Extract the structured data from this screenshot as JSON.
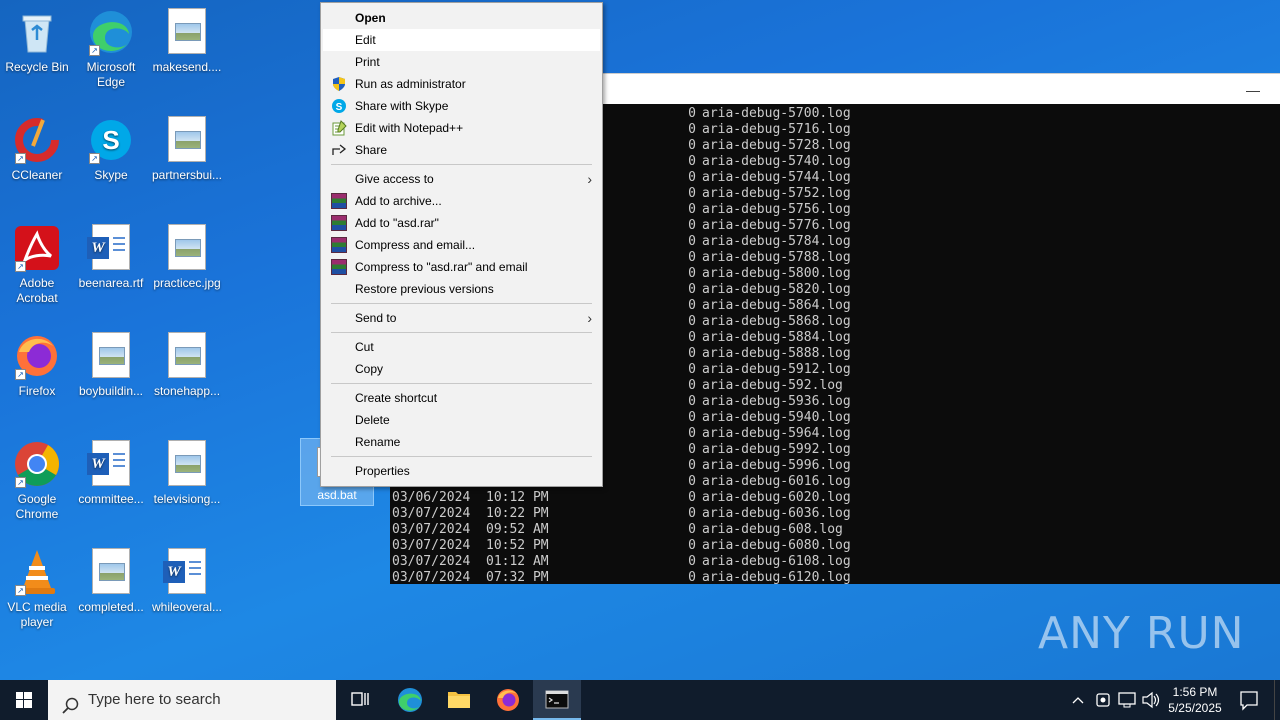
{
  "desktop": {
    "icons": [
      {
        "label": "Recycle Bin"
      },
      {
        "label": "Microsoft Edge"
      },
      {
        "label": "makesend...."
      },
      {
        "label": "CCleaner"
      },
      {
        "label": "Skype"
      },
      {
        "label": "partnersbui..."
      },
      {
        "label": "Adobe Acrobat"
      },
      {
        "label": "beenarea.rtf"
      },
      {
        "label": "practicec.jpg"
      },
      {
        "label": "Firefox"
      },
      {
        "label": "boybuildin..."
      },
      {
        "label": "stonehapp..."
      },
      {
        "label": "Google Chrome"
      },
      {
        "label": "committee..."
      },
      {
        "label": "televisiong..."
      },
      {
        "label": "VLC media player"
      },
      {
        "label": "completed..."
      },
      {
        "label": "whileoveral..."
      }
    ],
    "selected_file": "asd.bat"
  },
  "context_menu": {
    "items": [
      {
        "label": "Open"
      },
      {
        "label": "Edit"
      },
      {
        "label": "Print"
      },
      {
        "label": "Run as administrator"
      },
      {
        "label": "Share with Skype"
      },
      {
        "label": "Edit with Notepad++"
      },
      {
        "label": "Share"
      },
      {
        "label": "Give access to"
      },
      {
        "label": "Add to archive..."
      },
      {
        "label": "Add to \"asd.rar\""
      },
      {
        "label": "Compress and email..."
      },
      {
        "label": "Compress to \"asd.rar\" and email"
      },
      {
        "label": "Restore previous versions"
      },
      {
        "label": "Send to"
      },
      {
        "label": "Cut"
      },
      {
        "label": "Copy"
      },
      {
        "label": "Create shortcut"
      },
      {
        "label": "Delete"
      },
      {
        "label": "Rename"
      },
      {
        "label": "Properties"
      }
    ]
  },
  "console": {
    "minimize_glyph": "—",
    "rows": [
      {
        "date": "",
        "time": "",
        "size": "0",
        "name": "aria-debug-5700.log"
      },
      {
        "date": "",
        "time": "",
        "size": "0",
        "name": "aria-debug-5716.log"
      },
      {
        "date": "",
        "time": "",
        "size": "0",
        "name": "aria-debug-5728.log"
      },
      {
        "date": "",
        "time": "",
        "size": "0",
        "name": "aria-debug-5740.log"
      },
      {
        "date": "",
        "time": "",
        "size": "0",
        "name": "aria-debug-5744.log"
      },
      {
        "date": "",
        "time": "",
        "size": "0",
        "name": "aria-debug-5752.log"
      },
      {
        "date": "",
        "time": "",
        "size": "0",
        "name": "aria-debug-5756.log"
      },
      {
        "date": "",
        "time": "",
        "size": "0",
        "name": "aria-debug-5776.log"
      },
      {
        "date": "",
        "time": "",
        "size": "0",
        "name": "aria-debug-5784.log"
      },
      {
        "date": "",
        "time": "",
        "size": "0",
        "name": "aria-debug-5788.log"
      },
      {
        "date": "",
        "time": "",
        "size": "0",
        "name": "aria-debug-5800.log"
      },
      {
        "date": "",
        "time": "",
        "size": "0",
        "name": "aria-debug-5820.log"
      },
      {
        "date": "",
        "time": "",
        "size": "0",
        "name": "aria-debug-5864.log"
      },
      {
        "date": "",
        "time": "",
        "size": "0",
        "name": "aria-debug-5868.log"
      },
      {
        "date": "",
        "time": "",
        "size": "0",
        "name": "aria-debug-5884.log"
      },
      {
        "date": "",
        "time": "",
        "size": "0",
        "name": "aria-debug-5888.log"
      },
      {
        "date": "",
        "time": "",
        "size": "0",
        "name": "aria-debug-5912.log"
      },
      {
        "date": "",
        "time": "",
        "size": "0",
        "name": "aria-debug-592.log"
      },
      {
        "date": "",
        "time": "",
        "size": "0",
        "name": "aria-debug-5936.log"
      },
      {
        "date": "",
        "time": "",
        "size": "0",
        "name": "aria-debug-5940.log"
      },
      {
        "date": "",
        "time": "",
        "size": "0",
        "name": "aria-debug-5964.log"
      },
      {
        "date": "",
        "time": "",
        "size": "0",
        "name": "aria-debug-5992.log"
      },
      {
        "date": "",
        "time": "",
        "size": "0",
        "name": "aria-debug-5996.log"
      },
      {
        "date": "",
        "time": "",
        "size": "0",
        "name": "aria-debug-6016.log"
      },
      {
        "date": "03/06/2024",
        "time": "10:12 PM",
        "size": "0",
        "name": "aria-debug-6020.log"
      },
      {
        "date": "03/07/2024",
        "time": "10:22 PM",
        "size": "0",
        "name": "aria-debug-6036.log"
      },
      {
        "date": "03/07/2024",
        "time": "09:52 AM",
        "size": "0",
        "name": "aria-debug-608.log"
      },
      {
        "date": "03/07/2024",
        "time": "10:52 PM",
        "size": "0",
        "name": "aria-debug-6080.log"
      },
      {
        "date": "03/07/2024",
        "time": "01:12 AM",
        "size": "0",
        "name": "aria-debug-6108.log"
      },
      {
        "date": "03/07/2024",
        "time": "07:32 PM",
        "size": "0",
        "name": "aria-debug-6120.log"
      }
    ]
  },
  "taskbar": {
    "search_placeholder": "Type here to search",
    "time": "1:56 PM",
    "date": "5/25/2025"
  },
  "watermark": "ANY RUN",
  "colors": {
    "accent": "#1976d2",
    "taskbar": "#101c2c",
    "console_bg": "#0c0c0c"
  }
}
